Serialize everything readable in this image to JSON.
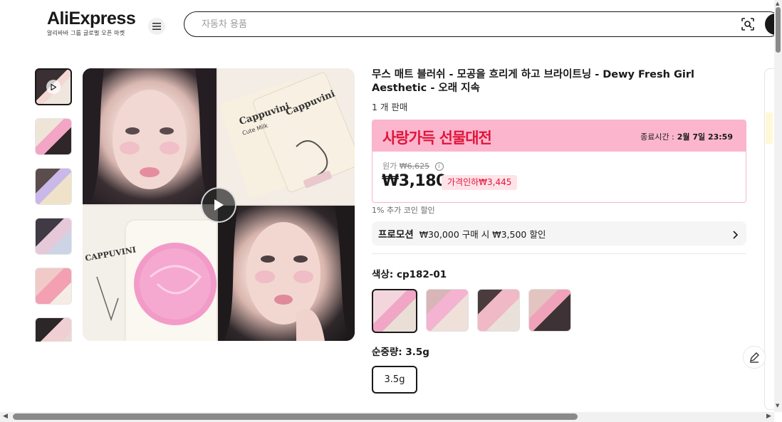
{
  "header": {
    "logo_main": "AliExpress",
    "logo_sub": "알리바바 그룹 글로벌 오픈 마켓",
    "search_placeholder": "자동차 용품"
  },
  "gallery": {
    "thumbnail_count": 6,
    "active_index": 0
  },
  "product": {
    "title": "무스 매트 블러쉬 - 모공을 흐리게 하고 브라이트닝 - Dewy Fresh Girl Aesthetic - 오래 지속",
    "sold": "1 개 판매",
    "image_text": {
      "brand_1": "Cappuvini",
      "brand_2": "Cute Milk",
      "brand_3": "CAPPUVINI"
    }
  },
  "promotion_banner": {
    "title": "사랑가득 선물대전",
    "end_label": "종료시간 :",
    "end_time": "2월 7일 23:59"
  },
  "price": {
    "original_label": "원가",
    "original_price": "₩6,625",
    "current_price": "₩3,180",
    "discount_tag": "가격인하₩3,445",
    "coin_note": "1% 추가 코인 할인"
  },
  "promo_row": {
    "label": "프로모션",
    "text": "₩30,000 구매 시 ₩3,500 할인"
  },
  "options": {
    "color_label": "색상: cp182-01",
    "weight_label": "순중량: 3.5g",
    "weight_value": "3.5g"
  },
  "colors": {
    "accent_red": "#e0153b",
    "banner_pink": "#fbb6cd",
    "discount_bg": "#ffe3e8",
    "text_dark": "#191919"
  }
}
